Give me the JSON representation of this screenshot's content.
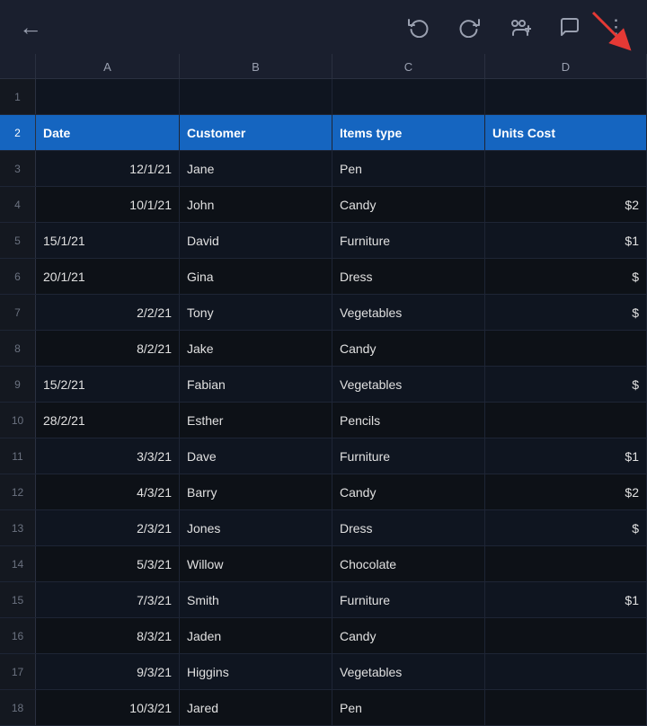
{
  "toolbar": {
    "back_icon": "←",
    "undo_icon": "↺",
    "redo_icon": "↻",
    "add_person_icon": "👤+",
    "comment_icon": "💬",
    "more_icon": "⋮"
  },
  "columns": {
    "headers": [
      "A",
      "B",
      "C",
      "D"
    ]
  },
  "rows": [
    {
      "num": "1",
      "a": "",
      "b": "",
      "c": "",
      "d": "",
      "isHeader": false,
      "isEmpty": true
    },
    {
      "num": "2",
      "a": "Date",
      "b": "Customer",
      "c": "Items type",
      "d": "Units Cost",
      "isHeader": true
    },
    {
      "num": "3",
      "a": "12/1/21",
      "b": "Jane",
      "c": "Pen",
      "d": "",
      "isHeader": false,
      "aRight": true
    },
    {
      "num": "4",
      "a": "10/1/21",
      "b": "John",
      "c": "Candy",
      "d": "$2",
      "isHeader": false,
      "aRight": true,
      "dRight": true
    },
    {
      "num": "5",
      "a": "15/1/21",
      "b": "David",
      "c": "Furniture",
      "d": "$1",
      "isHeader": false,
      "dRight": true
    },
    {
      "num": "6",
      "a": "20/1/21",
      "b": "Gina",
      "c": "Dress",
      "d": "$",
      "isHeader": false,
      "dRight": true
    },
    {
      "num": "7",
      "a": "2/2/21",
      "b": "Tony",
      "c": "Vegetables",
      "d": "$",
      "isHeader": false,
      "aRight": true,
      "dRight": true
    },
    {
      "num": "8",
      "a": "8/2/21",
      "b": "Jake",
      "c": "Candy",
      "d": "",
      "isHeader": false,
      "aRight": true
    },
    {
      "num": "9",
      "a": "15/2/21",
      "b": "Fabian",
      "c": "Vegetables",
      "d": "$",
      "isHeader": false,
      "dRight": true
    },
    {
      "num": "10",
      "a": "28/2/21",
      "b": "Esther",
      "c": "Pencils",
      "d": "",
      "isHeader": false
    },
    {
      "num": "11",
      "a": "3/3/21",
      "b": "Dave",
      "c": "Furniture",
      "d": "$1",
      "isHeader": false,
      "aRight": true,
      "dRight": true
    },
    {
      "num": "12",
      "a": "4/3/21",
      "b": "Barry",
      "c": "Candy",
      "d": "$2",
      "isHeader": false,
      "aRight": true,
      "dRight": true
    },
    {
      "num": "13",
      "a": "2/3/21",
      "b": "Jones",
      "c": "Dress",
      "d": "$",
      "isHeader": false,
      "aRight": true,
      "dRight": true
    },
    {
      "num": "14",
      "a": "5/3/21",
      "b": "Willow",
      "c": "Chocolate",
      "d": "",
      "isHeader": false,
      "aRight": true
    },
    {
      "num": "15",
      "a": "7/3/21",
      "b": "Smith",
      "c": "Furniture",
      "d": "$1",
      "isHeader": false,
      "aRight": true,
      "dRight": true
    },
    {
      "num": "16",
      "a": "8/3/21",
      "b": "Jaden",
      "c": "Candy",
      "d": "",
      "isHeader": false,
      "aRight": true
    },
    {
      "num": "17",
      "a": "9/3/21",
      "b": "Higgins",
      "c": "Vegetables",
      "d": "",
      "isHeader": false,
      "aRight": true
    },
    {
      "num": "18",
      "a": "10/3/21",
      "b": "Jared",
      "c": "Pen",
      "d": "",
      "isHeader": false,
      "aRight": true
    }
  ]
}
